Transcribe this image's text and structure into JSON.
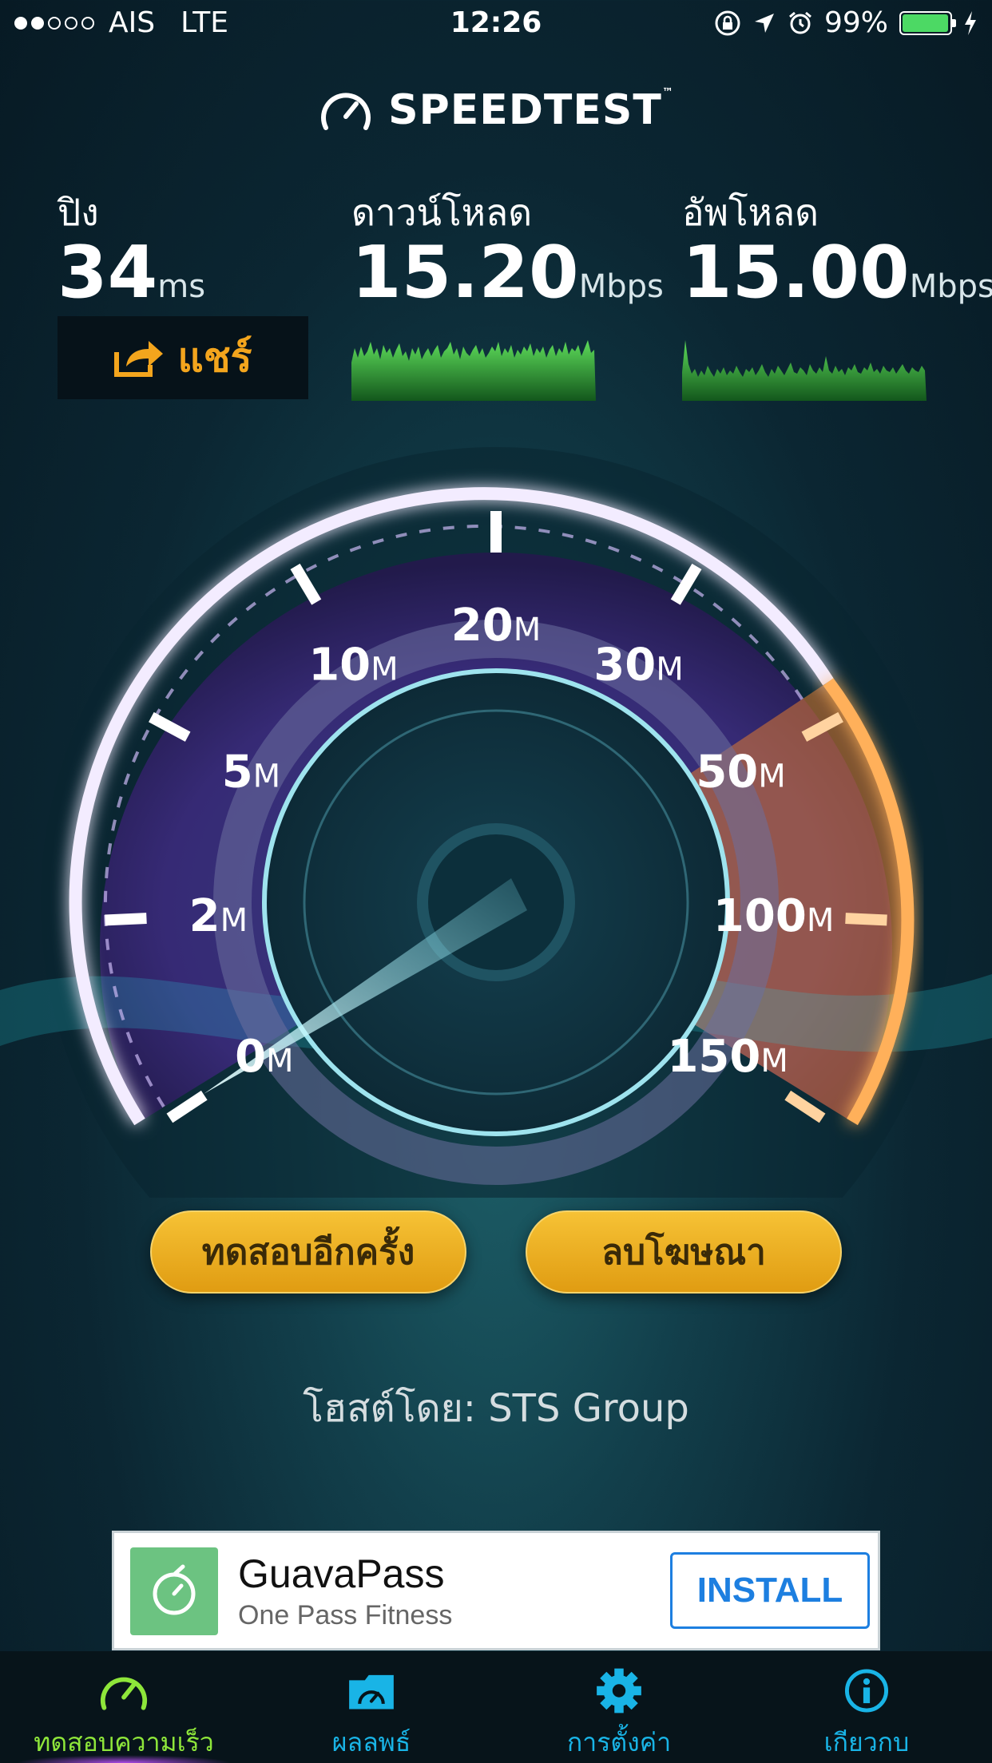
{
  "status_bar": {
    "carrier": "AIS",
    "network": "LTE",
    "time": "12:26",
    "battery": "99%",
    "battery_level": 0.99,
    "signal_bars_filled": 2,
    "signal_bars_total": 5
  },
  "app": {
    "logo_text": "SPEEDTEST",
    "trademark": "™"
  },
  "stats": {
    "ping": {
      "label": "ปิง",
      "value": "34",
      "unit": "ms"
    },
    "download": {
      "label": "ดาวน์โหลด",
      "value": "15.20",
      "unit": "Mbps"
    },
    "upload": {
      "label": "อัพโหลด",
      "value": "15.00",
      "unit": "Mbps"
    }
  },
  "share_button": {
    "label": "แชร์"
  },
  "gauge": {
    "ticks": [
      {
        "num": "0",
        "unit": "M"
      },
      {
        "num": "2",
        "unit": "M"
      },
      {
        "num": "5",
        "unit": "M"
      },
      {
        "num": "10",
        "unit": "M"
      },
      {
        "num": "20",
        "unit": "M"
      },
      {
        "num": "30",
        "unit": "M"
      },
      {
        "num": "50",
        "unit": "M"
      },
      {
        "num": "100",
        "unit": "M"
      },
      {
        "num": "150",
        "unit": "M"
      }
    ]
  },
  "buttons": {
    "test_again": "ทดสอบอีกครั้ง",
    "remove_ads": "ลบโฆษณา"
  },
  "host": {
    "text": "โฮสต์โดย: STS Group"
  },
  "ad": {
    "title": "GuavaPass",
    "subtitle": "One Pass Fitness",
    "install": "INSTALL"
  },
  "tabs": [
    {
      "label": "ทดสอบความเร็ว",
      "icon": "speedometer-icon",
      "active": true
    },
    {
      "label": "ผลลพธ์",
      "icon": "results-folder-icon",
      "active": false
    },
    {
      "label": "การตั้งค่า",
      "icon": "gear-icon",
      "active": false
    },
    {
      "label": "เกียวกบ",
      "icon": "info-icon",
      "active": false
    }
  ],
  "colors": {
    "accent_orange": "#f3a51d",
    "tab_active": "#8ee63a",
    "tab_inactive": "#19b4e6",
    "spark_green": "#3fbf45"
  }
}
